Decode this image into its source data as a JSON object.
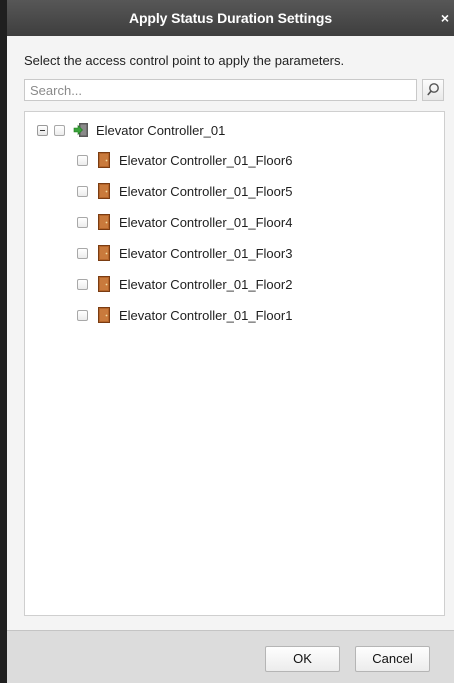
{
  "dialog": {
    "title": "Apply Status Duration Settings",
    "close_glyph": "×"
  },
  "instruction": "Select the access control point to apply the parameters.",
  "search": {
    "placeholder": "Search...",
    "value": "",
    "icon": "search-icon"
  },
  "tree": {
    "root": {
      "label": "Elevator Controller_01",
      "expanded": true,
      "checked": false,
      "icon": "elevator-controller-icon"
    },
    "children": [
      {
        "label": "Elevator Controller_01_Floor6",
        "checked": false,
        "icon": "door-icon"
      },
      {
        "label": "Elevator Controller_01_Floor5",
        "checked": false,
        "icon": "door-icon"
      },
      {
        "label": "Elevator Controller_01_Floor4",
        "checked": false,
        "icon": "door-icon"
      },
      {
        "label": "Elevator Controller_01_Floor3",
        "checked": false,
        "icon": "door-icon"
      },
      {
        "label": "Elevator Controller_01_Floor2",
        "checked": false,
        "icon": "door-icon"
      },
      {
        "label": "Elevator Controller_01_Floor1",
        "checked": false,
        "icon": "door-icon"
      }
    ]
  },
  "footer": {
    "ok_label": "OK",
    "cancel_label": "Cancel"
  },
  "colors": {
    "titlebar": "#4a4a4a",
    "door_icon": "#b5652a",
    "controller_arrow": "#3aa33a"
  }
}
